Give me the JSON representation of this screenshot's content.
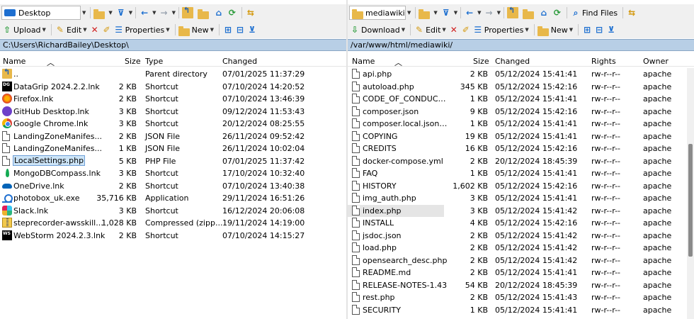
{
  "left": {
    "drive": "Desktop",
    "toolbar2": {
      "upload": "Upload",
      "edit": "Edit",
      "properties": "Properties",
      "new": "New"
    },
    "path": "C:\\Users\\RichardBailey\\Desktop\\",
    "columns": {
      "name": "Name",
      "size": "Size",
      "type": "Type",
      "changed": "Changed"
    },
    "files": [
      {
        "name": "..",
        "size": "",
        "type": "Parent directory",
        "changed": "07/01/2025 11:37:29",
        "icon": "parent-folder-icon"
      },
      {
        "name": "DataGrip 2024.2.2.lnk",
        "size": "2 KB",
        "type": "Shortcut",
        "changed": "07/10/2024 14:20:52",
        "icon": "datagrip-icon"
      },
      {
        "name": "Firefox.lnk",
        "size": "2 KB",
        "type": "Shortcut",
        "changed": "07/10/2024 13:46:39",
        "icon": "firefox-icon"
      },
      {
        "name": "GitHub Desktop.lnk",
        "size": "3 KB",
        "type": "Shortcut",
        "changed": "09/12/2024 11:53:43",
        "icon": "github-desktop-icon"
      },
      {
        "name": "Google Chrome.lnk",
        "size": "3 KB",
        "type": "Shortcut",
        "changed": "20/12/2024 08:25:55",
        "icon": "chrome-icon"
      },
      {
        "name": "LandingZoneManifes...",
        "size": "2 KB",
        "type": "JSON File",
        "changed": "26/11/2024 09:52:42",
        "icon": "document-icon"
      },
      {
        "name": "LandingZoneManifes...",
        "size": "1 KB",
        "type": "JSON File",
        "changed": "26/11/2024 10:02:04",
        "icon": "document-icon"
      },
      {
        "name": "LocalSettings.php",
        "size": "5 KB",
        "type": "PHP File",
        "changed": "07/01/2025 11:37:42",
        "icon": "document-icon"
      },
      {
        "name": "MongoDBCompass.lnk",
        "size": "3 KB",
        "type": "Shortcut",
        "changed": "17/10/2024 10:32:40",
        "icon": "mongodb-icon"
      },
      {
        "name": "OneDrive.lnk",
        "size": "2 KB",
        "type": "Shortcut",
        "changed": "07/10/2024 13:40:38",
        "icon": "onedrive-icon"
      },
      {
        "name": "photobox_uk.exe",
        "size": "35,716 KB",
        "type": "Application",
        "changed": "29/11/2024 16:51:26",
        "icon": "photobox-icon"
      },
      {
        "name": "Slack.lnk",
        "size": "3 KB",
        "type": "Shortcut",
        "changed": "16/12/2024 20:06:08",
        "icon": "slack-icon"
      },
      {
        "name": "steprecorder-awsskill...",
        "size": "1,028 KB",
        "type": "Compressed (zipp...",
        "changed": "19/11/2024 14:19:00",
        "icon": "zip-icon"
      },
      {
        "name": "WebStorm 2024.2.3.lnk",
        "size": "2 KB",
        "type": "Shortcut",
        "changed": "07/10/2024 14:15:27",
        "icon": "webstorm-icon"
      }
    ],
    "selected_index": 7
  },
  "right": {
    "drive": "mediawiki",
    "find_files": "Find Files",
    "toolbar2": {
      "download": "Download",
      "edit": "Edit",
      "properties": "Properties",
      "new": "New"
    },
    "path": "/var/www/html/mediawiki/",
    "columns": {
      "name": "Name",
      "size": "Size",
      "changed": "Changed",
      "rights": "Rights",
      "owner": "Owner"
    },
    "files": [
      {
        "name": "api.php",
        "size": "2 KB",
        "changed": "05/12/2024 15:41:41",
        "rights": "rw-r--r--",
        "owner": "apache"
      },
      {
        "name": "autoload.php",
        "size": "345 KB",
        "changed": "05/12/2024 15:42:16",
        "rights": "rw-r--r--",
        "owner": "apache"
      },
      {
        "name": "CODE_OF_CONDUCT...",
        "size": "1 KB",
        "changed": "05/12/2024 15:41:41",
        "rights": "rw-r--r--",
        "owner": "apache"
      },
      {
        "name": "composer.json",
        "size": "9 KB",
        "changed": "05/12/2024 15:42:16",
        "rights": "rw-r--r--",
        "owner": "apache"
      },
      {
        "name": "composer.local.json-...",
        "size": "1 KB",
        "changed": "05/12/2024 15:41:41",
        "rights": "rw-r--r--",
        "owner": "apache"
      },
      {
        "name": "COPYING",
        "size": "19 KB",
        "changed": "05/12/2024 15:41:41",
        "rights": "rw-r--r--",
        "owner": "apache"
      },
      {
        "name": "CREDITS",
        "size": "16 KB",
        "changed": "05/12/2024 15:42:16",
        "rights": "rw-r--r--",
        "owner": "apache"
      },
      {
        "name": "docker-compose.yml",
        "size": "2 KB",
        "changed": "20/12/2024 18:45:39",
        "rights": "rw-r--r--",
        "owner": "apache"
      },
      {
        "name": "FAQ",
        "size": "1 KB",
        "changed": "05/12/2024 15:41:41",
        "rights": "rw-r--r--",
        "owner": "apache"
      },
      {
        "name": "HISTORY",
        "size": "1,602 KB",
        "changed": "05/12/2024 15:42:16",
        "rights": "rw-r--r--",
        "owner": "apache"
      },
      {
        "name": "img_auth.php",
        "size": "3 KB",
        "changed": "05/12/2024 15:41:41",
        "rights": "rw-r--r--",
        "owner": "apache"
      },
      {
        "name": "index.php",
        "size": "3 KB",
        "changed": "05/12/2024 15:41:42",
        "rights": "rw-r--r--",
        "owner": "apache"
      },
      {
        "name": "INSTALL",
        "size": "4 KB",
        "changed": "05/12/2024 15:42:16",
        "rights": "rw-r--r--",
        "owner": "apache"
      },
      {
        "name": "jsdoc.json",
        "size": "2 KB",
        "changed": "05/12/2024 15:41:42",
        "rights": "rw-r--r--",
        "owner": "apache"
      },
      {
        "name": "load.php",
        "size": "2 KB",
        "changed": "05/12/2024 15:41:42",
        "rights": "rw-r--r--",
        "owner": "apache"
      },
      {
        "name": "opensearch_desc.php",
        "size": "2 KB",
        "changed": "05/12/2024 15:41:42",
        "rights": "rw-r--r--",
        "owner": "apache"
      },
      {
        "name": "README.md",
        "size": "2 KB",
        "changed": "05/12/2024 15:41:41",
        "rights": "rw-r--r--",
        "owner": "apache"
      },
      {
        "name": "RELEASE-NOTES-1.43",
        "size": "54 KB",
        "changed": "20/12/2024 18:45:39",
        "rights": "rw-r--r--",
        "owner": "apache"
      },
      {
        "name": "rest.php",
        "size": "2 KB",
        "changed": "05/12/2024 15:41:43",
        "rights": "rw-r--r--",
        "owner": "apache"
      },
      {
        "name": "SECURITY",
        "size": "1 KB",
        "changed": "05/12/2024 15:41:41",
        "rights": "rw-r--r--",
        "owner": "apache"
      }
    ],
    "highlighted_index": 11,
    "scroll_fraction": 0.55
  },
  "colors": {
    "path_bar": "#b8cfe6",
    "selection": "#cce4f7",
    "hover": "#e5e5e5",
    "folder": "#e8b84a"
  }
}
